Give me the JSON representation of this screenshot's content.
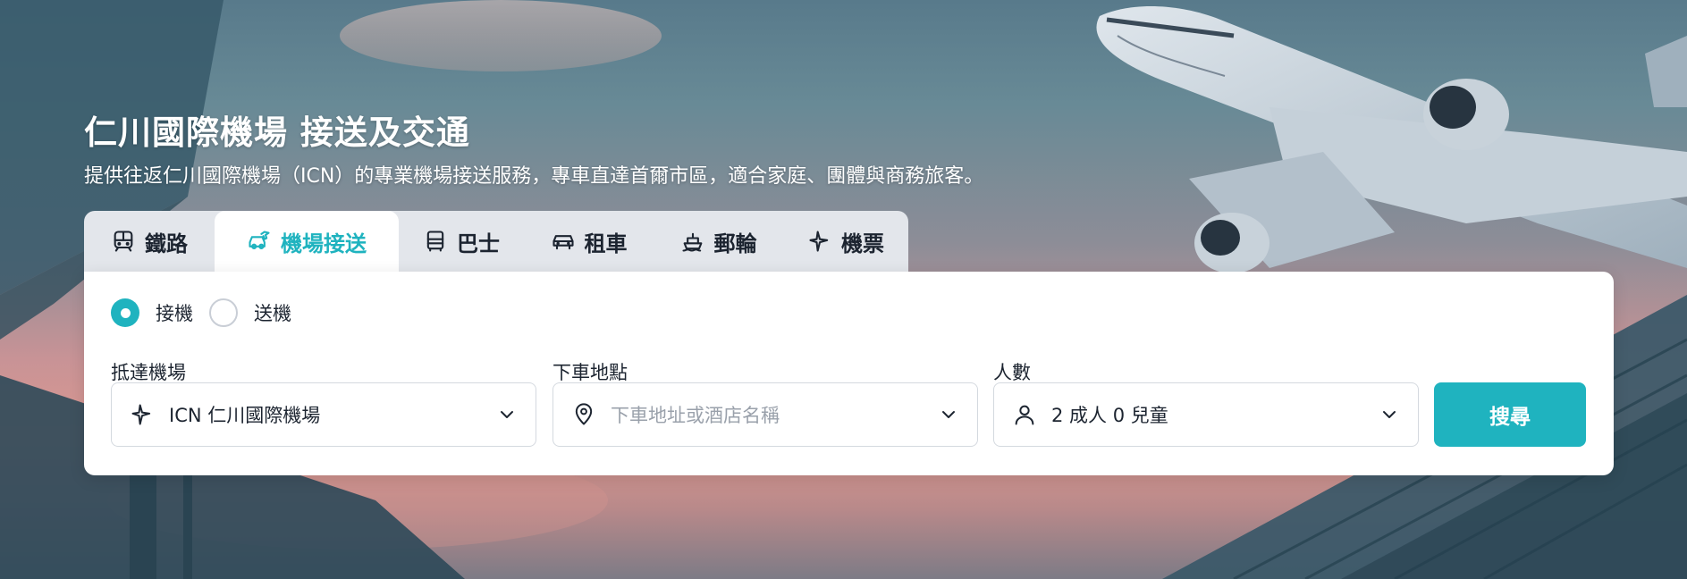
{
  "hero": {
    "title": "仁川國際機場 接送及交通",
    "subtitle": "提供往返仁川國際機場（ICN）的專業機場接送服務，專車直達首爾市區，適合家庭、團體與商務旅客。"
  },
  "tabs": [
    {
      "label": "鐵路",
      "icon": "train-icon",
      "active": false
    },
    {
      "label": "機場接送",
      "icon": "airport-transfer-icon",
      "active": true
    },
    {
      "label": "巴士",
      "icon": "bus-icon",
      "active": false
    },
    {
      "label": "租車",
      "icon": "car-icon",
      "active": false
    },
    {
      "label": "郵輪",
      "icon": "cruise-icon",
      "active": false
    },
    {
      "label": "機票",
      "icon": "plane-icon",
      "active": false
    }
  ],
  "booking": {
    "direction_options": [
      {
        "label": "接機",
        "checked": true
      },
      {
        "label": "送機",
        "checked": false
      }
    ],
    "arrival_airport": {
      "label": "抵達機場",
      "value": "ICN 仁川國際機場",
      "icon": "plane-icon"
    },
    "dropoff": {
      "label": "下車地點",
      "value": "",
      "placeholder": "下車地址或酒店名稱",
      "icon": "location-pin-icon"
    },
    "passengers": {
      "label": "人數",
      "value": "2 成人 0 兒童",
      "icon": "person-icon"
    },
    "search_label": "搜尋"
  },
  "colors": {
    "accent": "#1fb3bf",
    "text": "#1c2430",
    "tab_bar": "#e3e6eb",
    "placeholder": "#9aa1ab"
  }
}
